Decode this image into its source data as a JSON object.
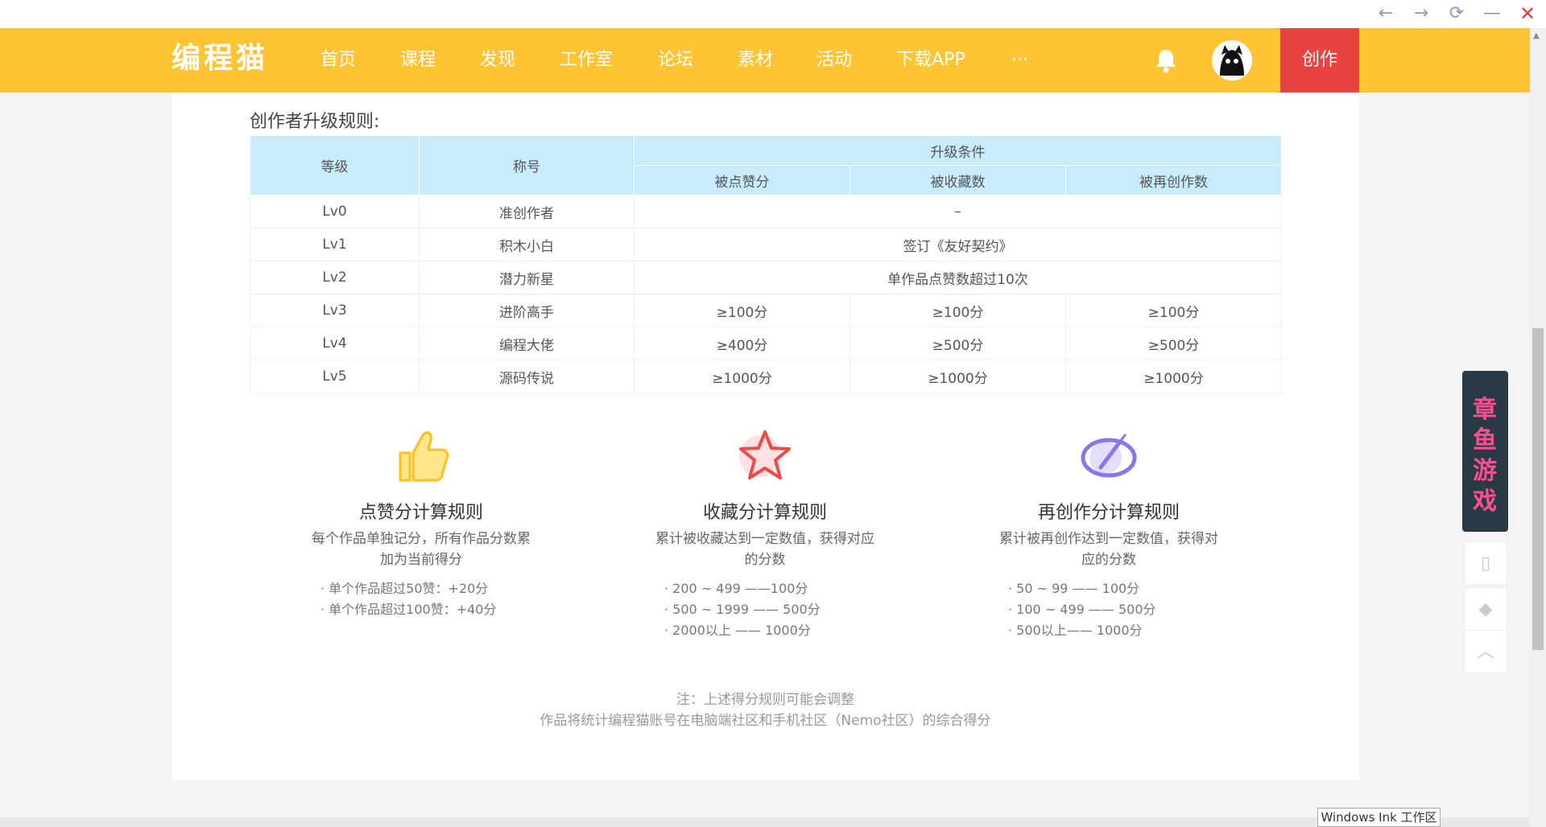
{
  "window": {
    "back": "←",
    "forward": "→",
    "refresh": "⟳",
    "minimize": "—",
    "close": "✕"
  },
  "nav": {
    "logo": "编程猫",
    "items": [
      "首页",
      "课程",
      "发现",
      "工作室",
      "论坛",
      "素材",
      "活动",
      "下载APP",
      "···"
    ],
    "create": "创作"
  },
  "main": {
    "section_title": "创作者升级规则:",
    "table": {
      "headers": {
        "level": "等级",
        "title": "称号",
        "condition": "升级条件",
        "likes": "被点赞分",
        "favorites": "被收藏数",
        "recreations": "被再创作数"
      },
      "rows": [
        {
          "level": "Lv0",
          "title": "准创作者",
          "merged": "–"
        },
        {
          "level": "Lv1",
          "title": "积木小白",
          "merged": "签订《友好契约》"
        },
        {
          "level": "Lv2",
          "title": "潜力新星",
          "merged": "单作品点赞数超过10次"
        },
        {
          "level": "Lv3",
          "title": "进阶高手",
          "likes": "≥100分",
          "favorites": "≥100分",
          "recreations": "≥100分"
        },
        {
          "level": "Lv4",
          "title": "编程大佬",
          "likes": "≥400分",
          "favorites": "≥500分",
          "recreations": "≥500分"
        },
        {
          "level": "Lv5",
          "title": "源码传说",
          "likes": "≥1000分",
          "favorites": "≥1000分",
          "recreations": "≥1000分"
        }
      ]
    },
    "cards": [
      {
        "icon": "thumbs-up-icon",
        "title": "点赞分计算规则",
        "desc": "每个作品单独记分，所有作品分数累加为当前得分",
        "items": [
          "· 单个作品超过50赞：+20分",
          "· 单个作品超过100赞：+40分"
        ]
      },
      {
        "icon": "star-icon",
        "title": "收藏分计算规则",
        "desc": "累计被收藏达到一定数值，获得对应的分数",
        "items": [
          "· 200 ~ 499 ——100分",
          "· 500 ~ 1999 —— 500分",
          "· 2000以上 —— 1000分"
        ]
      },
      {
        "icon": "recreate-icon",
        "title": "再创作分计算规则",
        "desc": "累计被再创作达到一定数值，获得对应的分数",
        "items": [
          "· 50 ~ 99 —— 100分",
          "· 100 ~ 499 —— 500分",
          "· 500以上—— 1000分"
        ]
      }
    ],
    "note1": "注：上述得分规则可能会调整",
    "note2": "作品将统计编程猫账号在电脑端社区和手机社区（Nemo社区）的综合得分"
  },
  "float": {
    "ad_text": "章鱼游戏"
  },
  "ink_label": "Windows Ink 工作区",
  "colors": {
    "nav_bg": "#fec433",
    "create_bg": "#e9433f",
    "table_header": "#c9ecfc"
  }
}
